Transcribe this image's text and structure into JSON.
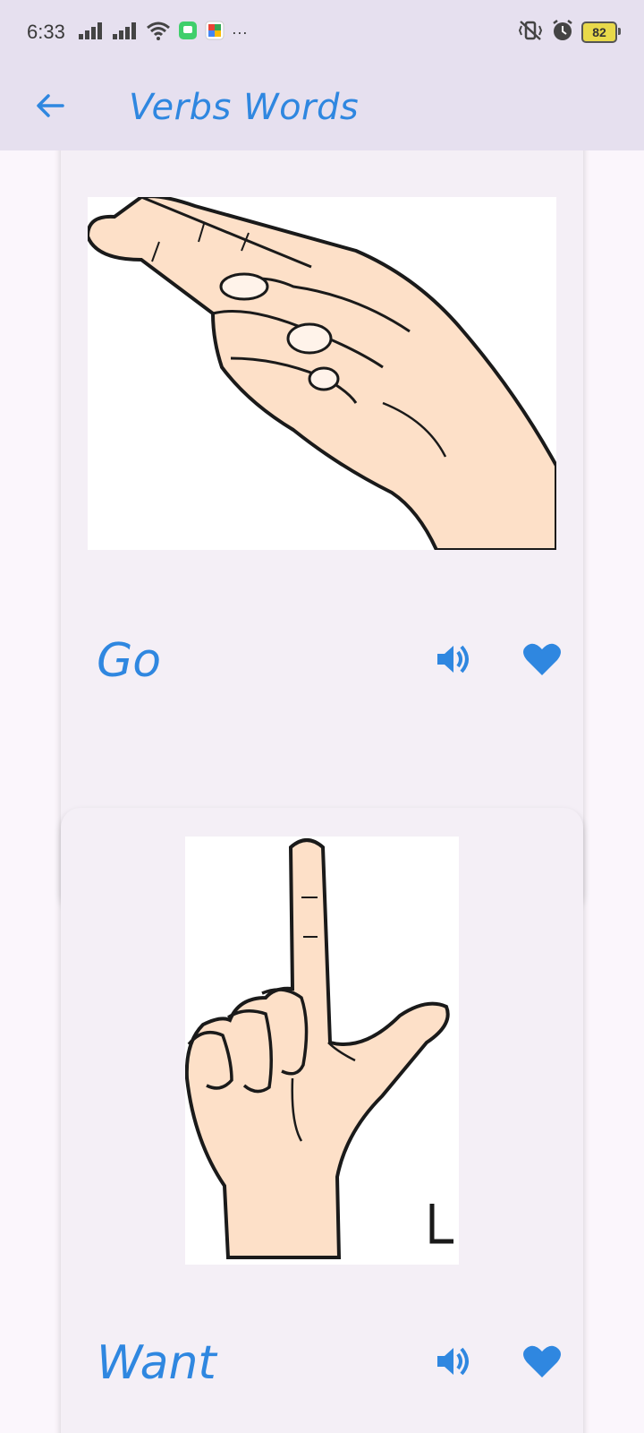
{
  "status_bar": {
    "time": "6:33",
    "more": "···",
    "battery": "82",
    "icons": [
      "signal-icon",
      "signal-icon",
      "wifi-icon",
      "chat-app-icon",
      "puzzle-app-icon",
      "vibrate-icon",
      "alarm-icon",
      "battery-icon"
    ]
  },
  "app_bar": {
    "title": "Verbs Words",
    "back_icon": "arrow-left-icon"
  },
  "colors": {
    "accent": "#2f87e0",
    "header_bg": "#e6e0ef",
    "card_bg": "#f4eff6",
    "skin": "#fde0c8"
  },
  "cards": [
    {
      "word": "Go",
      "image": "hand-sign-go",
      "actions": [
        "speaker-icon",
        "heart-icon"
      ]
    },
    {
      "word": "Want",
      "image": "hand-sign-want",
      "actions": [
        "speaker-icon",
        "heart-icon"
      ]
    }
  ]
}
